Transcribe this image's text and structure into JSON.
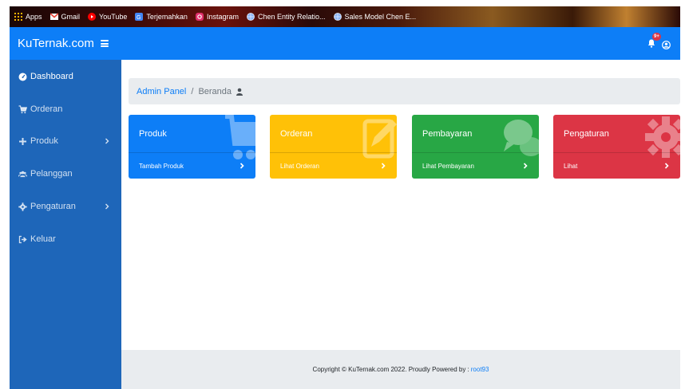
{
  "bookmarks": [
    {
      "label": "Apps",
      "icon": "apps-grid-icon",
      "color": "#f4b400"
    },
    {
      "label": "Gmail",
      "icon": "gmail-icon",
      "color": "#ea4335"
    },
    {
      "label": "YouTube",
      "icon": "youtube-icon",
      "color": "#ff0000"
    },
    {
      "label": "Terjemahkan",
      "icon": "translate-icon",
      "color": "#4285f4"
    },
    {
      "label": "Instagram",
      "icon": "instagram-icon",
      "color": "#e1306c"
    },
    {
      "label": "Chen Entity Relatio...",
      "icon": "globe-icon",
      "color": "#8ab4f8"
    },
    {
      "label": "Sales Model Chen E...",
      "icon": "globe-icon",
      "color": "#8ab4f8"
    }
  ],
  "navbar": {
    "brand": "KuTernak.com",
    "notification_badge": "9+",
    "color": "#0d7ef7"
  },
  "sidebar": {
    "color": "#1e66b9",
    "items": [
      {
        "label": "Dashboard",
        "icon": "tachometer-icon",
        "active": true,
        "has_submenu": false
      },
      {
        "label": "Orderan",
        "icon": "cart-icon",
        "active": false,
        "has_submenu": false
      },
      {
        "label": "Produk",
        "icon": "plus-icon",
        "active": false,
        "has_submenu": true
      },
      {
        "label": "Pelanggan",
        "icon": "users-icon",
        "active": false,
        "has_submenu": false
      },
      {
        "label": "Pengaturan",
        "icon": "gear-icon",
        "active": false,
        "has_submenu": true
      },
      {
        "label": "Keluar",
        "icon": "sign-out-icon",
        "active": false,
        "has_submenu": false
      }
    ]
  },
  "breadcrumb": {
    "link": "Admin Panel",
    "separator": "/",
    "current": "Beranda",
    "icon": "user-icon"
  },
  "cards": [
    {
      "title": "Produk",
      "link": "Tambah Produk",
      "color": "#0d7ef7",
      "icon": "cart-icon"
    },
    {
      "title": "Orderan",
      "link": "Lihat Orderan",
      "color": "#ffc107",
      "icon": "edit-icon"
    },
    {
      "title": "Pembayaran",
      "link": "Lihat Pembayaran",
      "color": "#28a745",
      "icon": "comments-icon"
    },
    {
      "title": "Pengaturan",
      "link": "Lihat",
      "color": "#dc3545",
      "icon": "gear-icon"
    }
  ],
  "footer": {
    "text": "Copyright © KuTernak.com 2022. Proudly Powered by :",
    "link": "root93"
  }
}
